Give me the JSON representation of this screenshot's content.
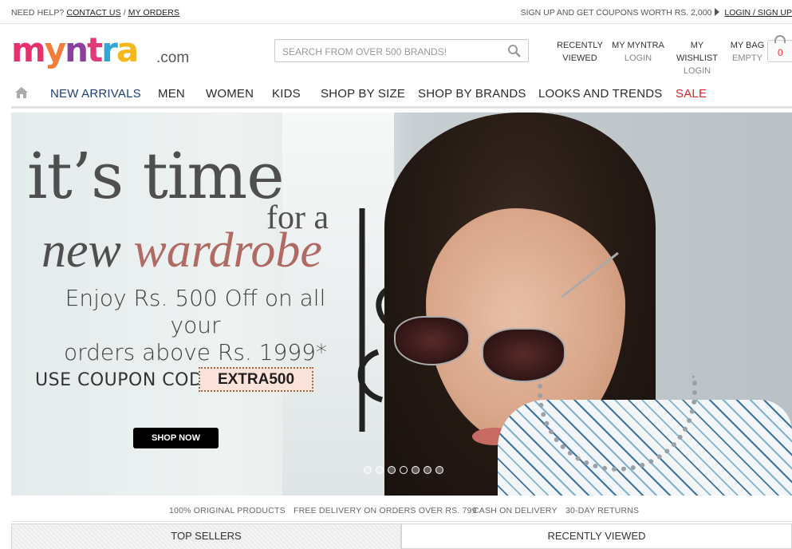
{
  "topbar": {
    "need_help": "NEED HELP?",
    "contact_us": "CONTACT US",
    "separator": "/",
    "my_orders": "MY ORDERS",
    "signup_promo": "SIGN UP AND GET COUPONS WORTH RS. 2,000",
    "login_signup": "LOGIN / SIGN UP"
  },
  "header": {
    "logo_text": "myntra",
    "logo_suffix": ".com",
    "search_placeholder": "SEARCH FROM OVER 500 BRANDS!",
    "recently_viewed_line1": "RECENTLY",
    "recently_viewed_line2": "VIEWED",
    "my_myntra": "MY MYNTRA",
    "my_myntra_sub": "LOGIN",
    "my_wishlist": "MY WISHLIST",
    "my_wishlist_sub": "LOGIN",
    "my_bag": "MY BAG",
    "my_bag_sub": "EMPTY",
    "bag_count": "0"
  },
  "nav": {
    "items": [
      "NEW ARRIVALS",
      "MEN",
      "WOMEN",
      "KIDS",
      "SHOP BY SIZE",
      "SHOP BY BRANDS",
      "LOOKS AND TRENDS",
      "SALE"
    ]
  },
  "banner": {
    "line1": "it’s time",
    "line2": "for a",
    "line3_a": "new",
    "line3_b": "wardrobe",
    "offer_line1": "Enjoy Rs. 500 Off on all your",
    "offer_line2": "orders above Rs. 1999*",
    "coupon_label": "USE COUPON CODE",
    "coupon_code": "EXTRA500",
    "cta": "SHOP NOW",
    "slide_count": 7,
    "active_slide": 4
  },
  "usp": [
    "100% ORIGINAL PRODUCTS",
    "FREE DELIVERY ON ORDERS OVER RS. 799",
    "CASH ON DELIVERY",
    "30-DAY RETURNS"
  ],
  "tabs": {
    "top_sellers": "TOP SELLERS",
    "recently_viewed": "RECENTLY VIEWED"
  },
  "colors": {
    "nav_first": "#1c3f74",
    "sale": "#d9252e",
    "coupon_bg": "#fbe3dc",
    "accent_script": "#b06a64"
  }
}
